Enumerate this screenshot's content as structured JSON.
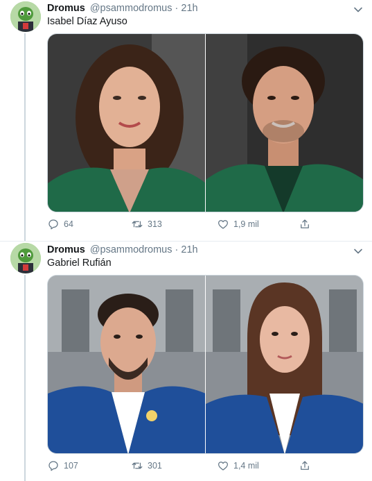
{
  "tweets": [
    {
      "author_name": "Dromus",
      "author_handle": "@psammodromus",
      "separator": "·",
      "time": "21h",
      "text": "Isabel Díaz Ayuso",
      "replies": "64",
      "retweets": "313",
      "likes": "1,9 mil"
    },
    {
      "author_name": "Dromus",
      "author_handle": "@psammodromus",
      "separator": "·",
      "time": "21h",
      "text": "Gabriel Rufián",
      "replies": "107",
      "retweets": "301",
      "likes": "1,4 mil"
    }
  ],
  "colors": {
    "secondary_text": "#657786",
    "divider": "#e6ecf0",
    "thread_line": "#ccd6dd"
  },
  "icons": [
    "chevron-down-icon",
    "reply-icon",
    "retweet-icon",
    "like-icon",
    "share-icon"
  ]
}
